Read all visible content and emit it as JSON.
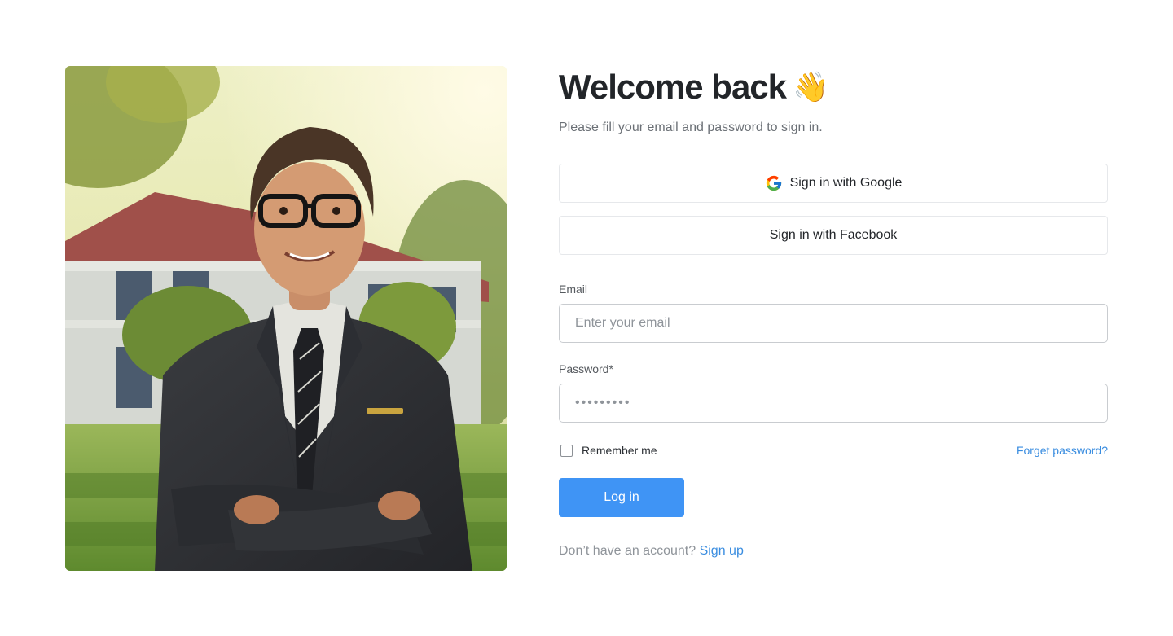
{
  "login": {
    "title": "Welcome back",
    "title_emoji": "👋",
    "subtitle": "Please fill your email and password to sign in.",
    "google_label": "Sign in with Google",
    "facebook_label": "Sign in with Facebook",
    "email_label": "Email",
    "email_placeholder": "Enter your email",
    "password_label": "Password*",
    "password_value": "•••••••••",
    "remember_label": "Remember me",
    "forgot_label": "Forget password?",
    "login_label": "Log in",
    "signup_prompt": "Don’t have an account?",
    "signup_link": "Sign up"
  },
  "icons": {
    "google": "google-g-logo",
    "wave": "waving-hand-emoji"
  },
  "colors": {
    "primary": "#3f94f5",
    "link": "#3a8de0",
    "title": "#222529",
    "muted": "#8f949a"
  }
}
